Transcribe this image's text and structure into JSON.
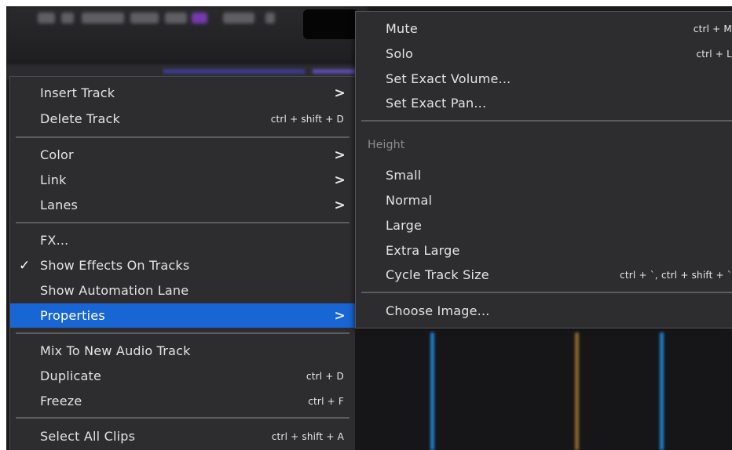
{
  "colors": {
    "menu_bg": "#2d2d2f",
    "highlight": "#1866d3",
    "separator": "#5c5c5e",
    "text": "#e4e4e4",
    "header_text": "#8e8e90"
  },
  "context_menu": {
    "items": [
      {
        "label": "Insert Track",
        "shortcut": "",
        "submenu": true
      },
      {
        "label": "Delete Track",
        "shortcut": "ctrl + shift + D",
        "submenu": false
      },
      {
        "label": "Color",
        "shortcut": "",
        "submenu": true
      },
      {
        "label": "Link",
        "shortcut": "",
        "submenu": true
      },
      {
        "label": "Lanes",
        "shortcut": "",
        "submenu": true
      },
      {
        "label": "FX...",
        "shortcut": "",
        "submenu": false
      },
      {
        "label": "Show Effects On Tracks",
        "shortcut": "",
        "submenu": false,
        "checked": true,
        "check_mark": "✓"
      },
      {
        "label": "Show Automation Lane",
        "shortcut": "",
        "submenu": false
      },
      {
        "label": "Properties",
        "shortcut": "",
        "submenu": true,
        "selected": true
      },
      {
        "label": "Mix To New Audio Track",
        "shortcut": "",
        "submenu": false
      },
      {
        "label": "Duplicate",
        "shortcut": "ctrl + D",
        "submenu": false
      },
      {
        "label": "Freeze",
        "shortcut": "ctrl + F",
        "submenu": false
      },
      {
        "label": "Select All Clips",
        "shortcut": "ctrl + shift + A",
        "submenu": false
      }
    ],
    "submenu_arrow": ">"
  },
  "properties_submenu": {
    "items": [
      {
        "label": "Mute",
        "shortcut": "ctrl + M"
      },
      {
        "label": "Solo",
        "shortcut": "ctrl + L"
      },
      {
        "label": "Set Exact Volume...",
        "shortcut": ""
      },
      {
        "label": "Set Exact Pan...",
        "shortcut": ""
      },
      {
        "label": "Small",
        "shortcut": ""
      },
      {
        "label": "Normal",
        "shortcut": ""
      },
      {
        "label": "Large",
        "shortcut": ""
      },
      {
        "label": "Extra Large",
        "shortcut": ""
      },
      {
        "label": "Cycle Track Size",
        "shortcut": "ctrl + `, ctrl + shift + `"
      },
      {
        "label": "Choose Image...",
        "shortcut": ""
      }
    ],
    "height_header": "Height"
  }
}
